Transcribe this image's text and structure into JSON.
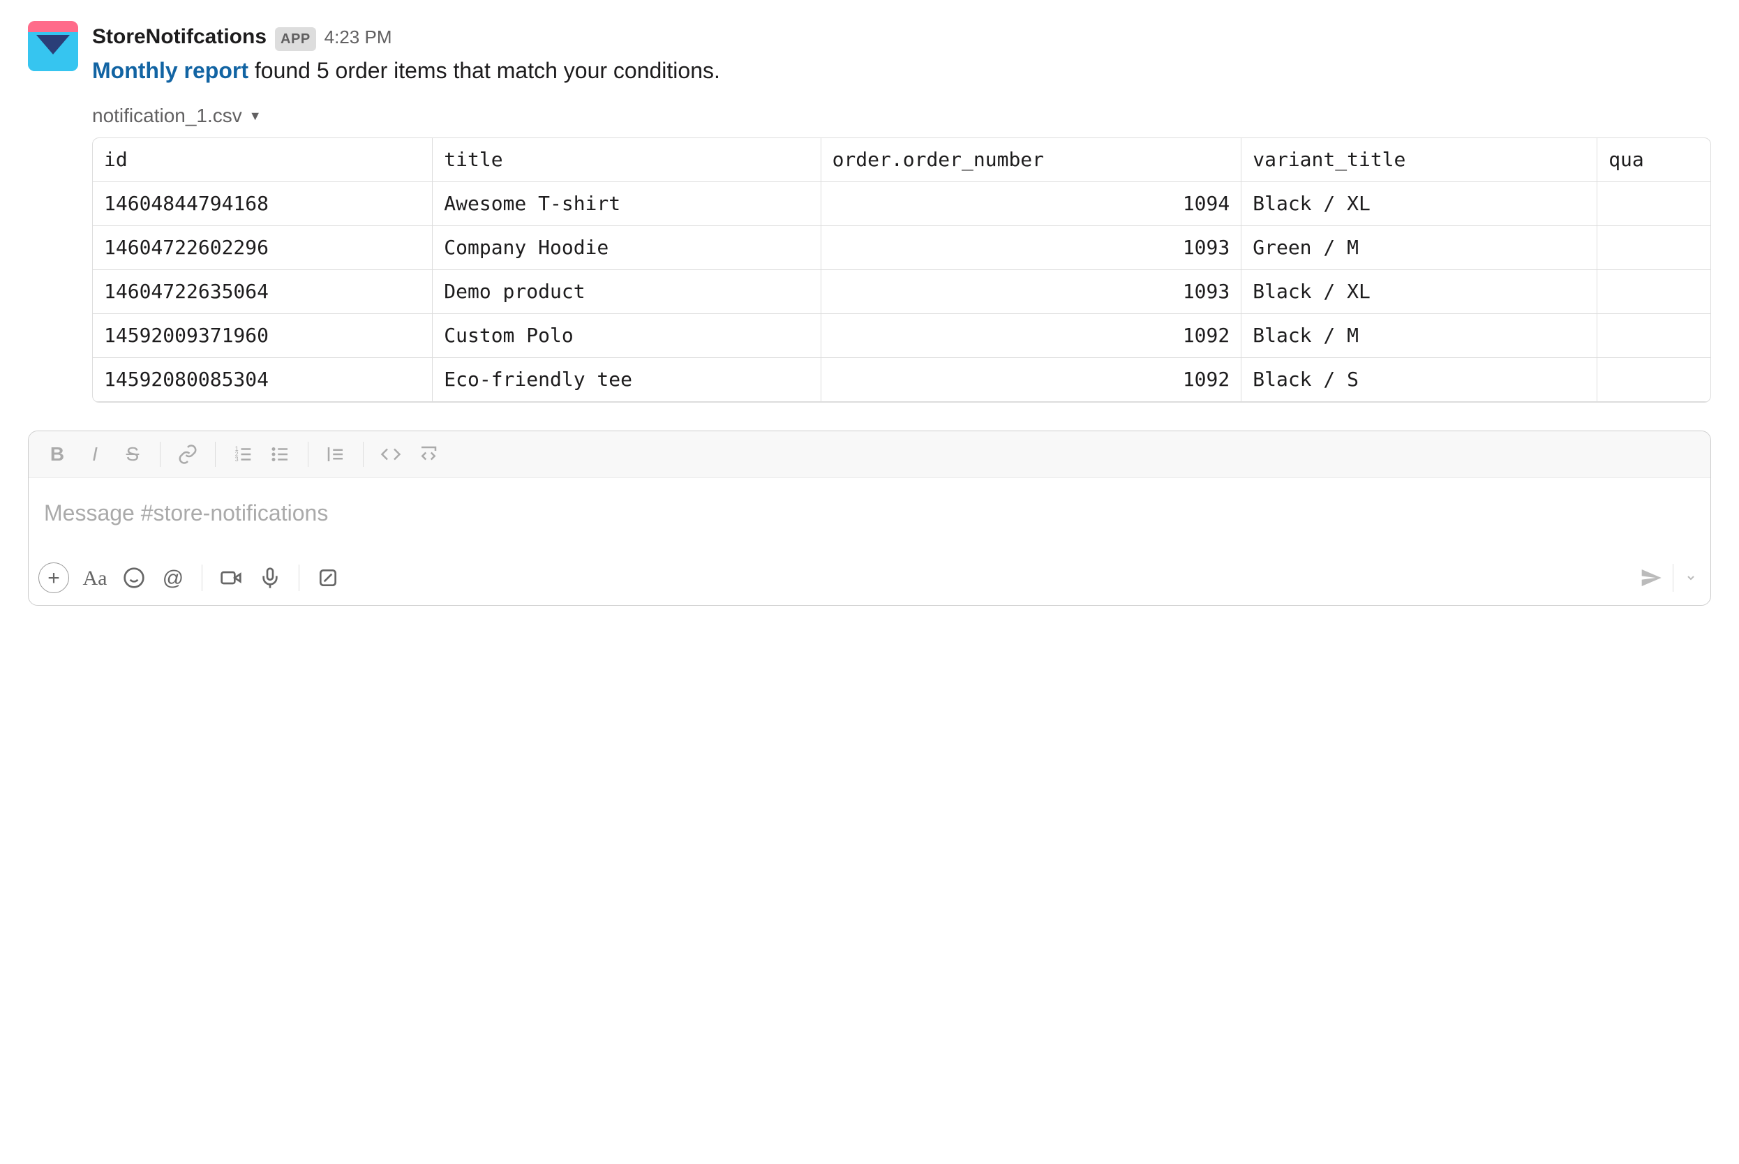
{
  "message": {
    "sender": "StoreNotifcations",
    "badge": "APP",
    "time": "4:23 PM",
    "link_text": "Monthly report",
    "rest_text": " found 5 order items that match your conditions."
  },
  "attachment": {
    "filename": "notification_1.csv",
    "columns": [
      "id",
      "title",
      "order.order_number",
      "variant_title",
      "qua"
    ],
    "rows": [
      {
        "id": "14604844794168",
        "title": "Awesome T-shirt",
        "order_number": "1094",
        "variant_title": "Black / XL"
      },
      {
        "id": "14604722602296",
        "title": "Company Hoodie",
        "order_number": "1093",
        "variant_title": "Green / M"
      },
      {
        "id": "14604722635064",
        "title": "Demo product",
        "order_number": "1093",
        "variant_title": "Black / XL"
      },
      {
        "id": "14592009371960",
        "title": "Custom Polo",
        "order_number": "1092",
        "variant_title": "Black / M"
      },
      {
        "id": "14592080085304",
        "title": "Eco-friendly tee",
        "order_number": "1092",
        "variant_title": "Black / S"
      }
    ]
  },
  "composer": {
    "placeholder": "Message #store-notifications"
  }
}
